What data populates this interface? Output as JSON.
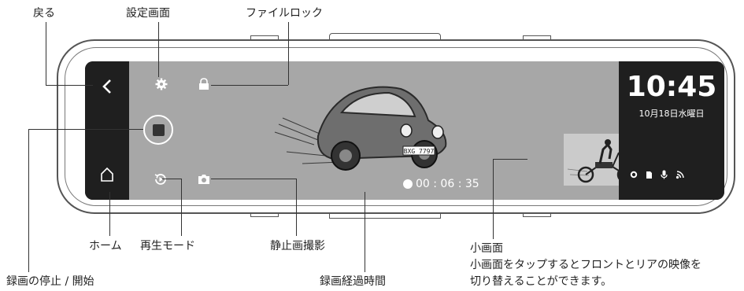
{
  "labels": {
    "back": "戻る",
    "settings": "設定画面",
    "file_lock": "ファイルロック",
    "home": "ホーム",
    "playback_mode": "再生モード",
    "still_capture": "静止画撮影",
    "sub_screen": "小画面",
    "sub_screen_desc_1": "小画面をタップするとフロントとリアの映像を",
    "sub_screen_desc_2": "切り替えることができます。",
    "stop_start_recording": "録画の停止 / 開始",
    "elapsed_time": "録画経過時間"
  },
  "screen": {
    "time": "10:45",
    "date": "10月18日水曜日",
    "rec_elapsed": "00 : 06 : 35",
    "plate": "BXG 7797"
  },
  "icons": {
    "back": "chevron-left-icon",
    "settings": "gear-icon",
    "lock": "lock-icon",
    "record": "record-stop-icon",
    "home": "home-icon",
    "playback": "playback-icon",
    "camera": "camera-icon",
    "status": [
      "gps-dot-icon",
      "sd-card-icon",
      "mic-icon",
      "wifi-icon"
    ]
  }
}
